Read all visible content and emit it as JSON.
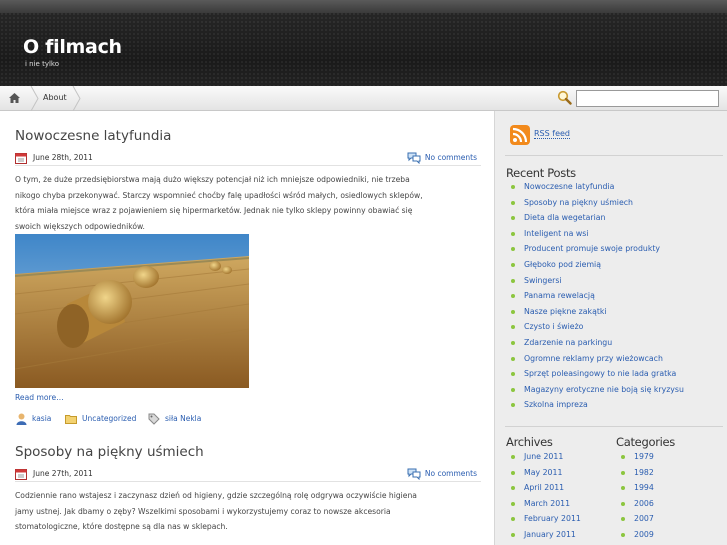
{
  "site": {
    "title": "O filmach",
    "description": "i nie tylko"
  },
  "nav": {
    "home_label": "home",
    "items": [
      "About"
    ]
  },
  "search": {
    "placeholder": ""
  },
  "posts": [
    {
      "title": "Nowoczesne latyfundia",
      "date": "June 28th, 2011",
      "comments": "No comments",
      "excerpt": [
        "O tym, że duże przedsiębiorstwa mają dużo większy potencjał niż ich mniejsze odpowiedniki, nie trzeba",
        "nikogo chyba przekonywać. Starczy wspomnieć choćby falę upadłości wśród małych, osiedlowych sklepów,",
        "która miała miejsce wraz z pojawieniem się hipermarketów. Jednak nie tylko sklepy powinny obawiać się",
        "swoich większych odpowiedników."
      ],
      "read_more": "Read more…",
      "author": "kasia",
      "category": "Uncategorized",
      "tag": "siła Nekla"
    },
    {
      "title": "Sposoby na piękny uśmiech",
      "date": "June 27th, 2011",
      "comments": "No comments",
      "excerpt": [
        "Codziennie rano wstajesz i zaczynasz dzień od higieny, gdzie szczególną rolę odgrywa oczywiście higiena",
        "jamy ustnej. Jak dbamy o zęby? Wszelkimi sposobami i wykorzystujemy coraz to nowsze akcesoria",
        "stomatologiczne, które dostępne są dla nas w sklepach."
      ]
    }
  ],
  "sidebar": {
    "rss_label": "RSS feed",
    "recent_title": "Recent Posts",
    "recent": [
      "Nowoczesne latyfundia",
      "Sposoby na piękny uśmiech",
      "Dieta dla wegetarian",
      "Inteligent na wsi",
      "Producent promuje swoje produkty",
      "Głęboko pod ziemią",
      "Swingersi",
      "Panama rewelacją",
      "Nasze piękne zakątki",
      "Czysto i świeżo",
      "Zdarzenie na parkingu",
      "Ogromne reklamy przy wieżowcach",
      "Sprzęt poleasingowy to nie lada gratka",
      "Magazyny erotyczne nie boją się kryzysu",
      "Szkolna impreza"
    ],
    "archives_title": "Archives",
    "archives": [
      "June 2011",
      "May 2011",
      "April 2011",
      "March 2011",
      "February 2011",
      "January 2011"
    ],
    "categories_title": "Categories",
    "categories": [
      "1979",
      "1982",
      "1994",
      "2006",
      "2007",
      "2009"
    ]
  },
  "colors": {
    "link": "#2a5db0",
    "bullet": "#8cc63f",
    "header": "#1f1f1f"
  }
}
